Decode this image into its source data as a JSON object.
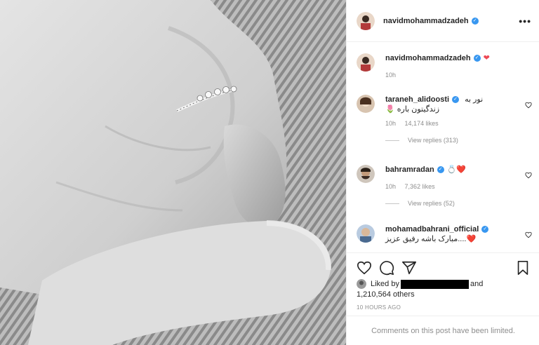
{
  "post": {
    "author": "navidmohammadzadeh",
    "more_icon": "•••"
  },
  "caption": {
    "author": "navidmohammadzadeh",
    "heart": "❤",
    "time": "10h"
  },
  "comments": [
    {
      "author": "taraneh_alidoosti",
      "text_line1": "نور به",
      "text_line2": "زندگیتون باره 🌷",
      "time": "10h",
      "likes": "14,174 likes",
      "replies": "View replies (313)"
    },
    {
      "author": "bahramradan",
      "text_line1": "❤️💍",
      "time": "10h",
      "likes": "7,362 likes",
      "replies": "View replies (52)"
    },
    {
      "author": "mohamadbahrani_official",
      "text_line1": "❤️....مبارک باشه رفیق عزیز"
    }
  ],
  "likes": {
    "prefix": "Liked by",
    "suffix": "and",
    "count": "1,210,564 others"
  },
  "timestamp": "10 HOURS AGO",
  "limited_notice": "Comments on this post have been limited.",
  "colors": {
    "verified": "#3897f0",
    "heart": "#ed4956",
    "muted": "#8e8e8e"
  },
  "icons": [
    "heart-icon",
    "comment-icon",
    "share-icon",
    "bookmark-icon",
    "more-icon",
    "verified-icon"
  ]
}
